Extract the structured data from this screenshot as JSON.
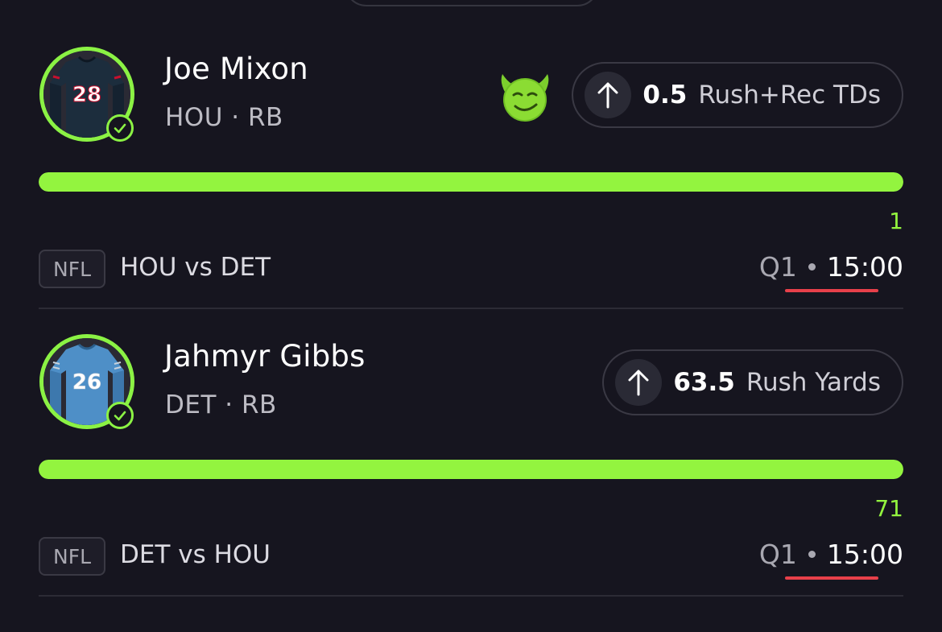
{
  "colors": {
    "background": "#16151f",
    "accent_green": "#93f43f",
    "underline_red": "#e8404a"
  },
  "picks": [
    {
      "player_name": "Joe Mixon",
      "team_pos": "HOU · RB",
      "jersey_number": "28",
      "jersey_color": "#1c2d3d",
      "direction": "arrow-up-icon",
      "line": "0.5",
      "stat": "Rush+Rec TDs",
      "has_emoji": true,
      "emoji": "smiling-devil-emoji-icon",
      "progress_fraction": 1.0,
      "actual": "1",
      "league": "NFL",
      "matchup": "HOU vs DET",
      "quarter": "Q1",
      "clock": "15:00"
    },
    {
      "player_name": "Jahmyr Gibbs",
      "team_pos": "DET · RB",
      "jersey_number": "26",
      "jersey_color": "#4e8fc7",
      "direction": "arrow-up-icon",
      "line": "63.5",
      "stat": "Rush Yards",
      "has_emoji": false,
      "progress_fraction": 1.0,
      "actual": "71",
      "league": "NFL",
      "matchup": "DET vs HOU",
      "quarter": "Q1",
      "clock": "15:00"
    }
  ]
}
